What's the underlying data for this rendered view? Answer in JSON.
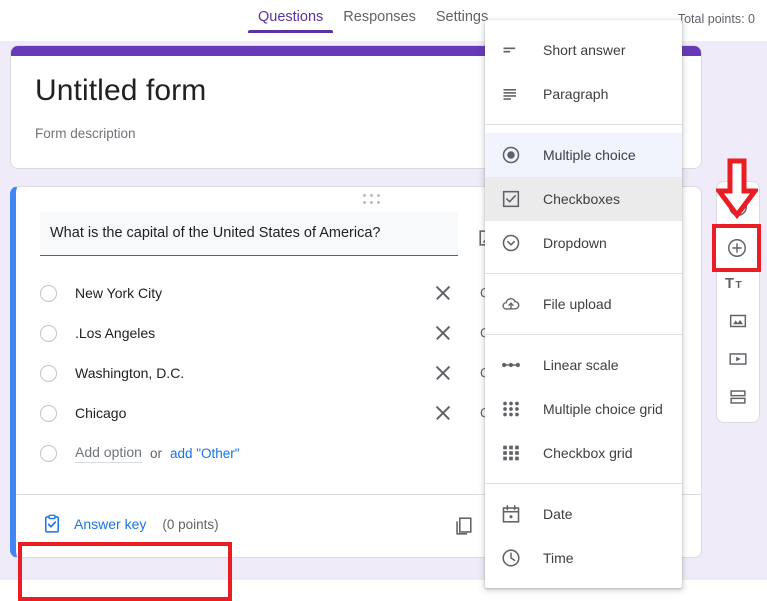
{
  "topbar": {
    "tabs": [
      {
        "label": "Questions",
        "active": true
      },
      {
        "label": "Responses",
        "active": false
      },
      {
        "label": "Settings",
        "active": false
      }
    ],
    "total_points": "Total points: 0"
  },
  "form": {
    "title": "Untitled form",
    "description": "Form description",
    "header_color": "#673ab7"
  },
  "question": {
    "accent_color": "#4285f4",
    "title": "What is the capital of the United States of America?",
    "options": [
      {
        "label": "New York City",
        "correct_label": "Co"
      },
      {
        "label": ".Los Angeles",
        "correct_label": "Co"
      },
      {
        "label": "Washington, D.C.",
        "correct_label": "Co"
      },
      {
        "label": "Chicago",
        "correct_label": "Co"
      }
    ],
    "add_option": "Add option",
    "or_word": "or",
    "add_other": "add \"Other\"",
    "answer_key_label": "Answer key",
    "answer_key_points": "(0 points)"
  },
  "toolbar": {
    "items": [
      {
        "icon": "add-question-icon",
        "name": "add-question-button"
      },
      {
        "icon": "import-questions-icon",
        "name": "import-questions-button"
      },
      {
        "icon": "add-title-icon",
        "name": "add-title-button"
      },
      {
        "icon": "add-image-icon",
        "name": "add-image-button"
      },
      {
        "icon": "add-video-icon",
        "name": "add-video-button"
      },
      {
        "icon": "add-section-icon",
        "name": "add-section-button"
      }
    ]
  },
  "type_menu": {
    "items": [
      {
        "label": "Short answer",
        "icon": "short-answer-icon",
        "state": "normal"
      },
      {
        "label": "Paragraph",
        "icon": "paragraph-icon",
        "state": "normal"
      },
      {
        "label": "Multiple choice",
        "icon": "multiple-choice-icon",
        "state": "selected"
      },
      {
        "label": "Checkboxes",
        "icon": "checkboxes-icon",
        "state": "hovered"
      },
      {
        "label": "Dropdown",
        "icon": "dropdown-icon",
        "state": "normal"
      },
      {
        "label": "File upload",
        "icon": "file-upload-icon",
        "state": "normal"
      },
      {
        "label": "Linear scale",
        "icon": "linear-scale-icon",
        "state": "normal"
      },
      {
        "label": "Multiple choice grid",
        "icon": "multiple-choice-grid-icon",
        "state": "normal"
      },
      {
        "label": "Checkbox grid",
        "icon": "checkbox-grid-icon",
        "state": "normal"
      },
      {
        "label": "Date",
        "icon": "date-icon",
        "state": "normal"
      },
      {
        "label": "Time",
        "icon": "time-icon",
        "state": "normal"
      }
    ]
  },
  "annotations": {
    "highlight_color": "#ea1c24",
    "arrow": "down-arrow-annotation",
    "boxes": [
      "answer-key-highlight-box",
      "add-question-highlight-box"
    ]
  }
}
